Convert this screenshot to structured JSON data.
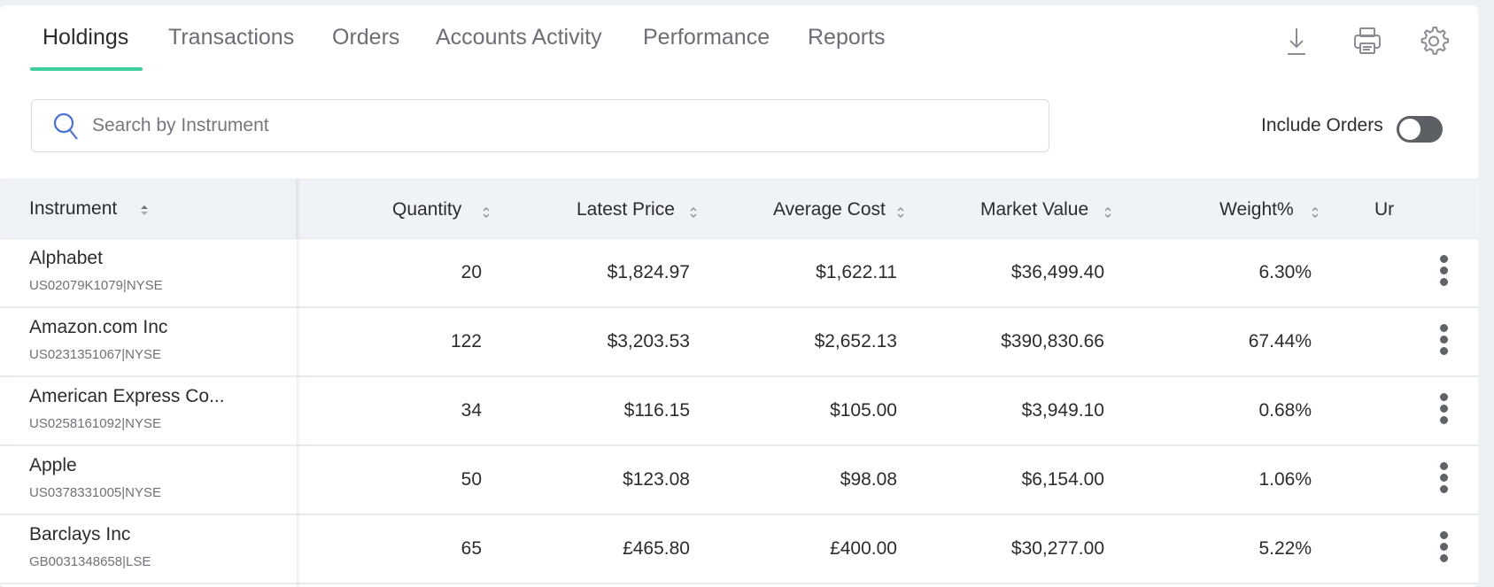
{
  "tabs": [
    {
      "label": "Holdings",
      "active": true
    },
    {
      "label": "Transactions",
      "active": false
    },
    {
      "label": "Orders",
      "active": false
    },
    {
      "label": "Accounts Activity",
      "active": false
    },
    {
      "label": "Performance",
      "active": false
    },
    {
      "label": "Reports",
      "active": false
    }
  ],
  "toolbar": {
    "icons": [
      "download-icon",
      "print-icon",
      "gear-icon"
    ]
  },
  "search": {
    "placeholder": "Search by Instrument",
    "value": ""
  },
  "include_orders": {
    "label": "Include Orders",
    "enabled": false
  },
  "table": {
    "columns": [
      "Instrument",
      "Quantity",
      "Latest Price",
      "Average Cost",
      "Market Value",
      "Weight%",
      "Ur"
    ],
    "rows": [
      {
        "name": "Alphabet",
        "id": "US02079K1079|NYSE",
        "quantity": "20",
        "latest_price": "$1,824.97",
        "average_cost": "$1,622.11",
        "market_value": "$36,499.40",
        "weight": "6.30%"
      },
      {
        "name": "Amazon.com Inc",
        "id": "US0231351067|NYSE",
        "quantity": "122",
        "latest_price": "$3,203.53",
        "average_cost": "$2,652.13",
        "market_value": "$390,830.66",
        "weight": "67.44%"
      },
      {
        "name": "American Express Co...",
        "id": "US0258161092|NYSE",
        "quantity": "34",
        "latest_price": "$116.15",
        "average_cost": "$105.00",
        "market_value": "$3,949.10",
        "weight": "0.68%"
      },
      {
        "name": "Apple",
        "id": "US0378331005|NYSE",
        "quantity": "50",
        "latest_price": "$123.08",
        "average_cost": "$98.08",
        "market_value": "$6,154.00",
        "weight": "1.06%"
      },
      {
        "name": "Barclays Inc",
        "id": "GB0031348658|LSE",
        "quantity": "65",
        "latest_price": "£465.80",
        "average_cost": "£400.00",
        "market_value": "$30,277.00",
        "weight": "5.22%"
      }
    ]
  },
  "colors": {
    "accent": "#3ecf9c",
    "toggle_off": "#5c5f64",
    "header_bg": "#f0f3f6"
  }
}
